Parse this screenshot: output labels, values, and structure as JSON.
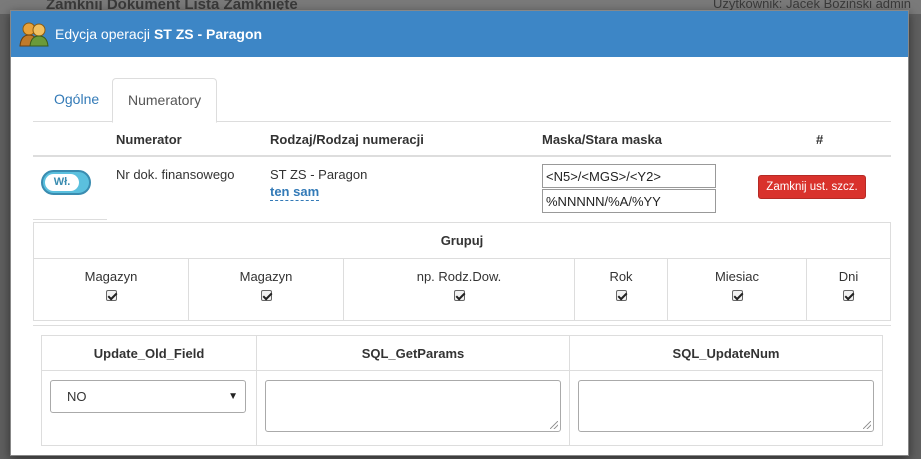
{
  "background": {
    "left_text": "Zamknij Dokument Lista Zamknięte",
    "right_text": "Użytkownik: Jacek Boziński admin"
  },
  "header": {
    "title_prefix": "Edycja operacji",
    "title_bold": "ST ZS - Paragon",
    "color": "#3d86c6"
  },
  "tabs": [
    {
      "label": "Ogólne",
      "active": false
    },
    {
      "label": "Numeratory",
      "active": true
    }
  ],
  "numerator_table": {
    "columns": [
      "Numerator",
      "Rodzaj/Rodzaj numeracji",
      "Maska/Stara maska",
      "#"
    ],
    "row": {
      "toggle_label": "Wł.",
      "numerator": "Nr dok. finansowego",
      "rodzaj": "ST ZS - Paragon",
      "rodzaj_link": "ten sam",
      "mask": "<N5>/<MGS>/<Y2>",
      "old_mask": "%NNNNN/%A/%YY",
      "action_label": "Zamknij ust. szcz."
    }
  },
  "grupuj": {
    "title": "Grupuj",
    "items": [
      {
        "label": "Magazyn",
        "checked": true
      },
      {
        "label": "Magazyn",
        "checked": true
      },
      {
        "label": "np. Rodz.Dow.",
        "checked": true
      },
      {
        "label": "Rok",
        "checked": true
      },
      {
        "label": "Miesiac",
        "checked": true
      },
      {
        "label": "Dni",
        "checked": true
      }
    ]
  },
  "update_table": {
    "columns": [
      "Update_Old_Field",
      "SQL_GetParams",
      "SQL_UpdateNum"
    ],
    "update_old_field_value": "NO",
    "sql_get_params": "",
    "sql_update_num": ""
  },
  "colors": {
    "danger": "#d9322c",
    "toggle": "#5bc0de",
    "link": "#337ab7"
  }
}
